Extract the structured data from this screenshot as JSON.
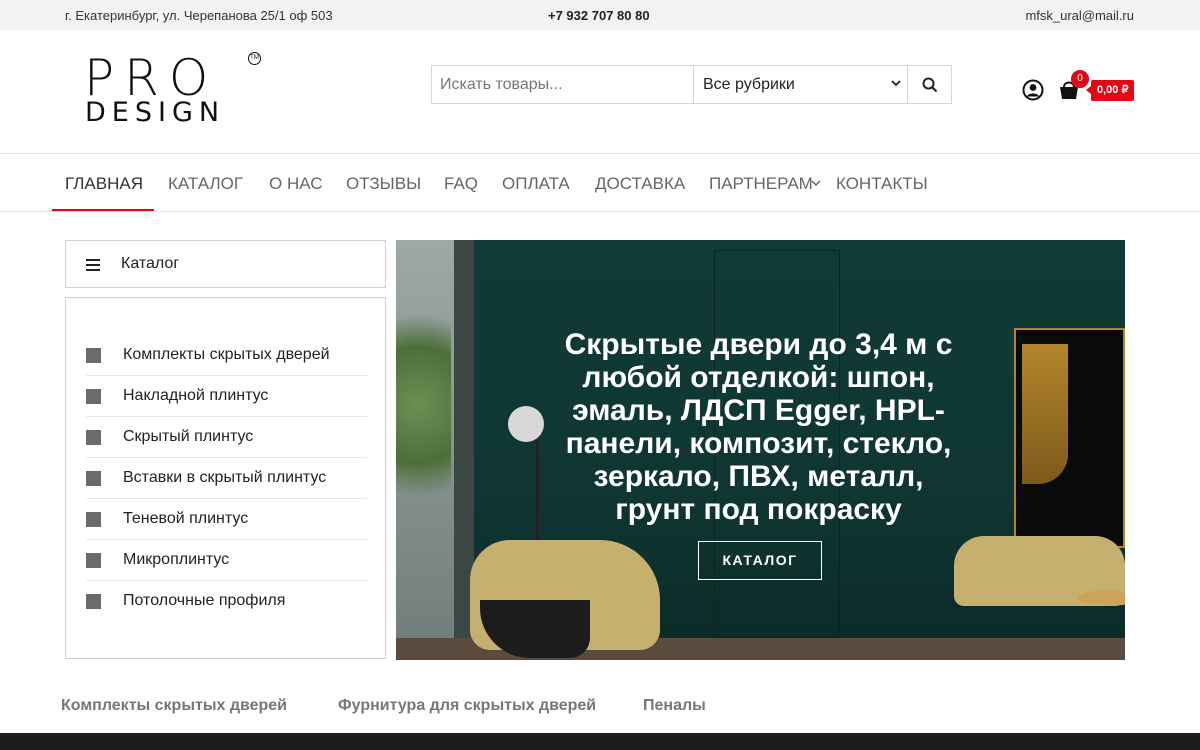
{
  "topbar": {
    "address": "г. Екатеринбург, ул. Черепанова 25/1 оф 503",
    "phone": "+7 932 707 80 80",
    "email": "mfsk_ural@mail.ru"
  },
  "logo": {
    "line1": "PRO",
    "line2": "DESIGN",
    "tm": "TM"
  },
  "search": {
    "placeholder": "Искать товары...",
    "category": "Все рубрики",
    "button_icon": "search-icon"
  },
  "cart": {
    "count": "0",
    "total": "0,00 ₽"
  },
  "nav": {
    "items": [
      "ГЛАВНАЯ",
      "КАТАЛОГ",
      "О НАС",
      "ОТЗЫВЫ",
      "FAQ",
      "ОПЛАТА",
      "ДОСТАВКА",
      "ПАРТНЕРАМ",
      "КОНТАКТЫ"
    ],
    "active": "ГЛАВНАЯ"
  },
  "catalog": {
    "title": "Каталог",
    "items": [
      "Комплекты скрытых дверей",
      "Накладной плинтус",
      "Скрытый плинтус",
      "Вставки в скрытый плинтус",
      "Теневой плинтус",
      "Микроплинтус",
      "Потолочные профиля"
    ]
  },
  "banner": {
    "headline": "Скрытые двери до 3,4 м с любой отделкой: шпон, эмаль, ЛДСП Egger, HPL-панели, композит, стекло, зеркало, ПВХ, металл, грунт под покраску",
    "button": "КАТАЛОГ"
  },
  "tabs": [
    "Комплекты скрытых дверей",
    "Фурнитура для скрытых дверей",
    "Пеналы"
  ],
  "colors": {
    "accent": "#e30613",
    "banner_bg": "#103a36",
    "topbar_bg": "#f2f2f2"
  }
}
